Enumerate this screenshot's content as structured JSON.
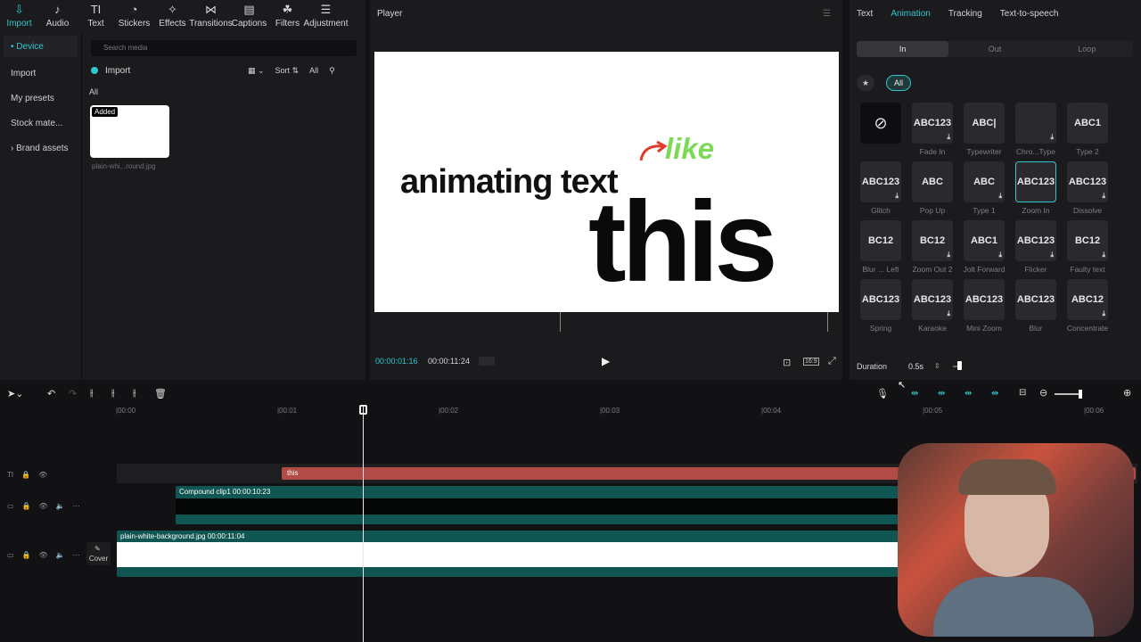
{
  "toolbar": {
    "items": [
      {
        "label": "Import",
        "icon": "import-icon",
        "active": true
      },
      {
        "label": "Audio",
        "icon": "audio-icon"
      },
      {
        "label": "Text",
        "icon": "text-icon"
      },
      {
        "label": "Stickers",
        "icon": "sticker-icon"
      },
      {
        "label": "Effects",
        "icon": "effects-icon"
      },
      {
        "label": "Transitions",
        "icon": "transitions-icon"
      },
      {
        "label": "Captions",
        "icon": "captions-icon"
      },
      {
        "label": "Filters",
        "icon": "filters-icon"
      },
      {
        "label": "Adjustment",
        "icon": "adjustment-icon"
      }
    ]
  },
  "leftnav": {
    "items": [
      "• Device",
      "Import",
      "My presets",
      "Stock mate...",
      "› Brand assets"
    ]
  },
  "media": {
    "search_placeholder": "Search media",
    "import_label": "Import",
    "sort_label": "Sort",
    "all_filter": "All",
    "section_label": "All",
    "thumb_badge": "Added",
    "thumb_name": "plain-whi...round.jpg"
  },
  "player": {
    "title": "Player",
    "text_main": "animating text",
    "text_this": "this",
    "text_like": "like",
    "time_current": "00:00:01:16",
    "time_total": "00:00:11:24",
    "ratio": "16:9"
  },
  "rightpanel": {
    "tabs": [
      "Text",
      "Animation",
      "Tracking",
      "Text-to-speech"
    ],
    "active_tab": "Animation",
    "segments": [
      "In",
      "Out",
      "Loop"
    ],
    "filter_all": "All",
    "presets": [
      {
        "name": "",
        "glyph": "⃠"
      },
      {
        "name": "Fade In",
        "glyph": "ABC123",
        "dl": true
      },
      {
        "name": "Typewriter",
        "glyph": "ABC|"
      },
      {
        "name": "Chro...Type",
        "glyph": "",
        "dl": true
      },
      {
        "name": "Type 2",
        "glyph": "ABC1"
      },
      {
        "name": "Glitch",
        "glyph": "ABC123",
        "dl": true
      },
      {
        "name": "Pop Up",
        "glyph": "ABC"
      },
      {
        "name": "Type 1",
        "glyph": "ABC",
        "dl": true
      },
      {
        "name": "Zoom In",
        "glyph": "ABC123",
        "selected": true
      },
      {
        "name": "Dissolve",
        "glyph": "ABC123",
        "dl": true
      },
      {
        "name": "Blur ... Left",
        "glyph": "BC12"
      },
      {
        "name": "Zoom Out 2",
        "glyph": "BC12",
        "dl": true
      },
      {
        "name": "Jolt Forward",
        "glyph": "ABC1",
        "dl": true
      },
      {
        "name": "Flicker",
        "glyph": "ABC123",
        "dl": true
      },
      {
        "name": "Faulty text",
        "glyph": "BC12",
        "dl": true
      },
      {
        "name": "Spring",
        "glyph": "ABC123"
      },
      {
        "name": "Karaoke",
        "glyph": "ABC123",
        "dl": true
      },
      {
        "name": "Mini Zoom",
        "glyph": "ABC123"
      },
      {
        "name": "Blur",
        "glyph": "ABC123"
      },
      {
        "name": "Concentrate",
        "glyph": "ABC12",
        "dl": true
      }
    ],
    "duration_label": "Duration",
    "duration_value": "0.5s"
  },
  "timeline": {
    "ticks": [
      "00:00",
      "00:01",
      "00:02",
      "00:03",
      "00:04",
      "00:05",
      "00:06"
    ],
    "text_clip": "this",
    "compound_clip": "Compound clip1  00:00:10:23",
    "bg_clip": "plain-white-background.jpg  00:00:11:04",
    "cover_label": "Cover"
  }
}
